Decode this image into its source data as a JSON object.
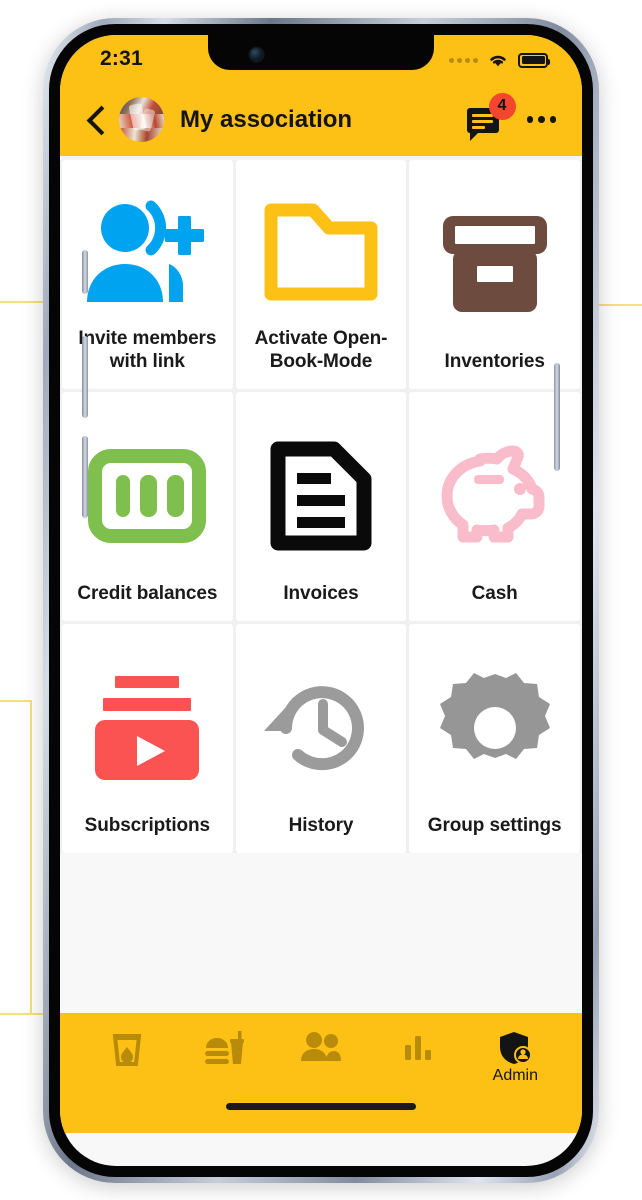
{
  "status_bar": {
    "time": "2:31",
    "signal_icon": "signal-dots-icon",
    "wifi_icon": "wifi-icon",
    "battery_icon": "battery-full-icon"
  },
  "app_bar": {
    "back_icon": "back-chevron-icon",
    "avatar_icon": "group-photo-avatar",
    "title": "My association",
    "chat_icon": "chat-bubble-icon",
    "chat_badge_count": "4",
    "overflow_icon": "more-options-kebab-icon",
    "background_color": "#FDC014"
  },
  "grid": {
    "tiles": [
      {
        "label": "Invite members with link",
        "icon": "person-add-icon",
        "color": "#00A3F0"
      },
      {
        "label": "Activate Open-Book-Mode",
        "icon": "folder-icon",
        "color": "#FDC014"
      },
      {
        "label": "Inventories",
        "icon": "archive-box-icon",
        "color": "#6E4B3F"
      },
      {
        "label": "Credit balances",
        "icon": "banknote-100-icon",
        "color": "#7FBF4D"
      },
      {
        "label": "Invoices",
        "icon": "document-lines-icon",
        "color": "#0A0A0A"
      },
      {
        "label": "Cash",
        "icon": "piggy-bank-icon",
        "color": "#F9BCCB"
      },
      {
        "label": "Subscriptions",
        "icon": "video-play-stack-icon",
        "color": "#FB5252"
      },
      {
        "label": "History",
        "icon": "clock-rewind-icon",
        "color": "#9B9B9B"
      },
      {
        "label": "Group settings",
        "icon": "gear-icon",
        "color": "#969696"
      }
    ]
  },
  "bottom_nav": {
    "items": [
      {
        "label": "",
        "icon": "drink-glass-icon",
        "active": false
      },
      {
        "label": "",
        "icon": "food-burger-drink-icon",
        "active": false
      },
      {
        "label": "",
        "icon": "people-icon",
        "active": false
      },
      {
        "label": "",
        "icon": "bar-chart-icon",
        "active": false
      },
      {
        "label": "Admin",
        "icon": "shield-admin-icon",
        "active": true
      }
    ],
    "background_color": "#FDC014",
    "inactive_color": "#B98B0A",
    "active_color": "#141414"
  },
  "home_indicator": "home-indicator-bar"
}
